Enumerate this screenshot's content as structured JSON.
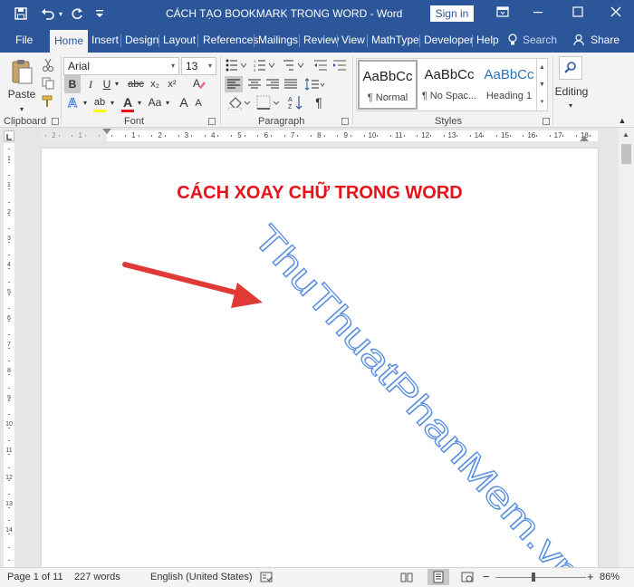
{
  "titlebar": {
    "doc_title": "CÁCH TẠO BOOKMARK TRONG WORD  -  Word",
    "signin": "Sign in",
    "icons": [
      "save-icon",
      "undo-icon",
      "redo-icon",
      "customize-qat-icon",
      "ribbon-display-icon",
      "minimize-icon",
      "maximize-icon",
      "close-icon"
    ]
  },
  "tabs": [
    "File",
    "Home",
    "Insert",
    "Design",
    "Layout",
    "References",
    "Mailings",
    "Review",
    "View",
    "MathType",
    "Developer",
    "Help"
  ],
  "tell_me": "Search",
  "share": "Share",
  "ribbon": {
    "clipboard": {
      "paste": "Paste",
      "label": "Clipboard"
    },
    "font": {
      "name": "Arial",
      "size": "13",
      "label": "Font",
      "bold": "B",
      "italic": "I",
      "underline": "U",
      "strike": "abc",
      "subscript": "x₂",
      "superscript": "x²",
      "highlight": "ab",
      "font_color": "A",
      "change_case": "Aa",
      "grow": "A",
      "shrink": "A",
      "highlight_color": "#ffff00",
      "font_color_value": "#e8121b"
    },
    "paragraph": {
      "label": "Paragraph",
      "show_marks": "¶"
    },
    "styles": {
      "label": "Styles",
      "items": [
        {
          "preview": "AaBbCc",
          "name": "¶ Normal"
        },
        {
          "preview": "AaBbCc",
          "name": "¶ No Spac..."
        },
        {
          "preview": "AaBbCc",
          "name": "Heading 1"
        }
      ]
    },
    "editing": {
      "label": "Editing"
    }
  },
  "ruler": {
    "labels": [
      "2",
      "1",
      "1",
      "2",
      "3",
      "4",
      "5",
      "6",
      "7",
      "8",
      "9",
      "10",
      "11",
      "12",
      "13",
      "14",
      "15",
      "16",
      "17",
      "18"
    ]
  },
  "vruler": {
    "labels": [
      "1",
      "1",
      "2",
      "3",
      "4",
      "5",
      "6",
      "7",
      "8",
      "9",
      "10",
      "11",
      "12",
      "13",
      "14"
    ]
  },
  "document": {
    "heading": "CÁCH XOAY CHỮ TRONG WORD",
    "rotated_text": "ThuThuatPhanMem.vn",
    "rotation_deg": 48,
    "heading_color": "#e8121b",
    "wordart_color": "#5b8fe0",
    "arrow_color": "#e03a36"
  },
  "statusbar": {
    "page": "Page 1 of 11",
    "words": "227 words",
    "language": "English (United States)",
    "zoom": "86%",
    "zoom_level": 0.86
  },
  "colors": {
    "accent": "#2b579a",
    "ribbon_bg": "#f3f3f3"
  }
}
